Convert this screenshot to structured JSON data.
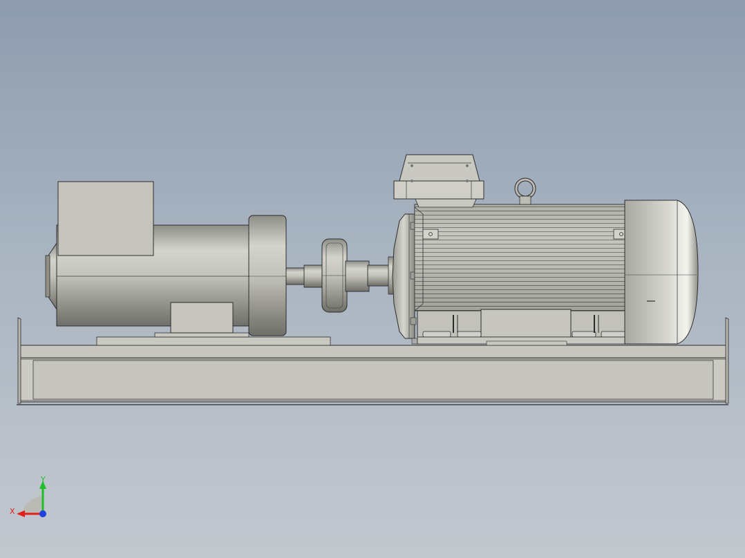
{
  "view": {
    "background_top": "#8d9cae",
    "background_bottom": "#c3c8cf",
    "model_color": "#c9c9c2",
    "edge_color": "#2b2b2b"
  },
  "triad": {
    "x_label": "X",
    "y_label": "Y",
    "x_color": "#e0201c",
    "y_color": "#1fbf2a",
    "z_color": "#1f3fe0"
  }
}
